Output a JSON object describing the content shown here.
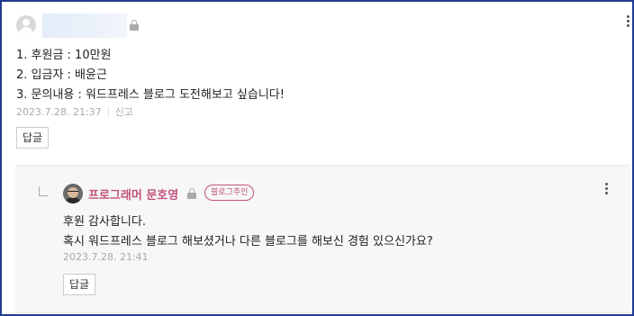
{
  "comment": {
    "avatar_icon": "user-avatar-icon",
    "lines": [
      "1. 후원금 : 10만원",
      "2. 입금자 : 배윤근",
      "3. 문의내용 : 워드프레스 블로그 도전해보고 싶습니다!"
    ],
    "date": "2023.7.28. 21:37",
    "report_label": "신고",
    "reply_button": "답글"
  },
  "reply": {
    "author": "프로그래머 문호영",
    "badge": "블로그주인",
    "lines": [
      "후원 감사합니다.",
      "혹시 워드프레스 블로그 해보셨거나 다른 블로그를 해보신 경험 있으신가요?"
    ],
    "date": "2023.7.28. 21:41",
    "reply_button": "답글"
  },
  "colors": {
    "owner_accent": "#c2527e",
    "frame_border": "#1f3b8f"
  }
}
